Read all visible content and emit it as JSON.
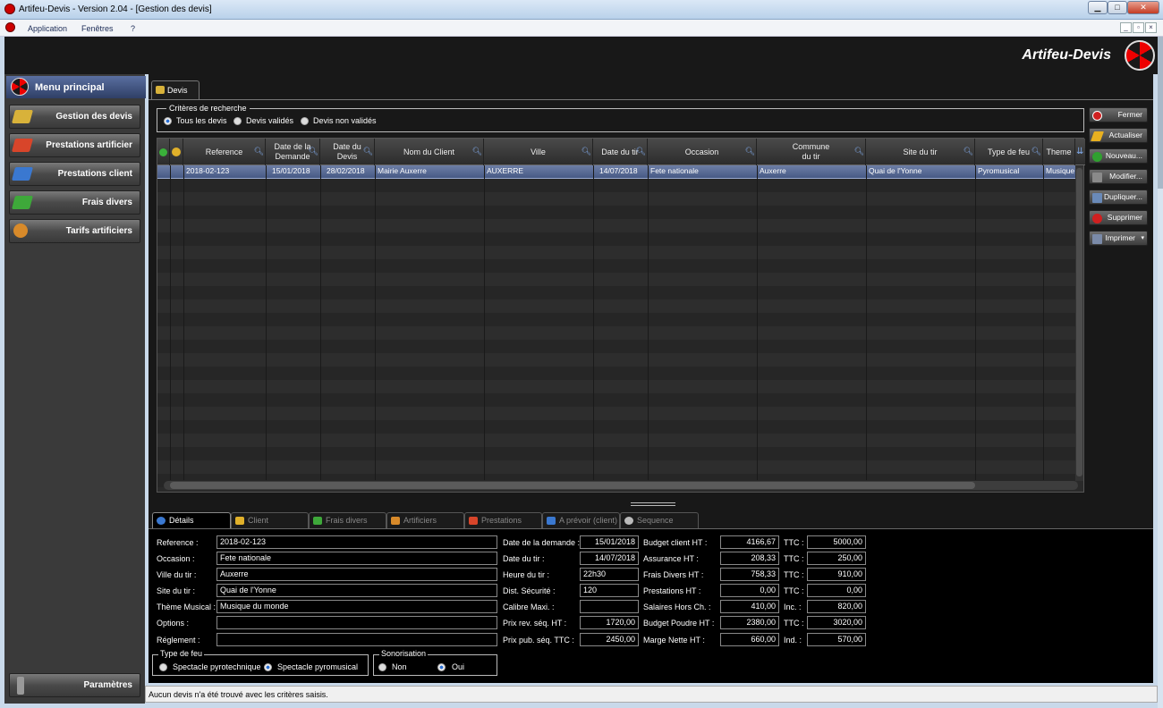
{
  "window": {
    "title": "Artifeu-Devis - Version 2.04 - [Gestion des devis]",
    "minimize": "▁",
    "maximize": "□",
    "close": "✕"
  },
  "menu": {
    "items": [
      "Application",
      "Fenêtres",
      "?"
    ],
    "mdi": [
      "_",
      "▫",
      "×"
    ]
  },
  "brand": "Artifeu-Devis",
  "sidebar": {
    "header": "Menu principal",
    "items": [
      {
        "label": "Gestion des devis",
        "color": "#d8b23a"
      },
      {
        "label": "Prestations artificier",
        "color": "#d8452a"
      },
      {
        "label": "Prestations client",
        "color": "#3a78d0"
      },
      {
        "label": "Frais divers",
        "color": "#3ea83a"
      },
      {
        "label": "Tarifs artificiers",
        "color": "#d88a2a"
      }
    ],
    "footer": "Paramètres"
  },
  "main": {
    "tab": "Devis",
    "criteria": {
      "legend": "Critères de recherche",
      "options": [
        "Tous les devis",
        "Devis validés",
        "Devis non validés"
      ],
      "selected": 0
    },
    "grid": {
      "columns": [
        {
          "label": "Reference"
        },
        {
          "label": "Date de la\nDemande"
        },
        {
          "label": "Date du\nDevis"
        },
        {
          "label": "Nom du Client"
        },
        {
          "label": "Ville"
        },
        {
          "label": "Date du tir"
        },
        {
          "label": "Occasion"
        },
        {
          "label": "Commune\ndu tir"
        },
        {
          "label": "Site du tir"
        },
        {
          "label": "Type de feu"
        },
        {
          "label": "Theme"
        }
      ],
      "rows": [
        [
          "2018-02-123",
          "15/01/2018",
          "28/02/2018",
          "Mairie Auxerre",
          "AUXERRE",
          "14/07/2018",
          "Fete nationale",
          "Auxerre",
          "Quai de l'Yonne",
          "Pyromusical",
          "Musique"
        ]
      ]
    },
    "actions": [
      {
        "label": "Fermer",
        "icon_color": "#d02020"
      },
      {
        "label": "Actualiser",
        "icon_color": "#e8b020"
      },
      {
        "label": "Nouveau...",
        "icon_color": "#30a030"
      },
      {
        "label": "Modifier...",
        "icon_color": "#8a8a8a"
      },
      {
        "label": "Dupliquer...",
        "icon_color": "#6a8ab8"
      },
      {
        "label": "Supprimer",
        "icon_color": "#d02020"
      },
      {
        "label": "Imprimer",
        "icon_color": "#7a8aa8"
      }
    ],
    "bottom_tabs": [
      "Détails",
      "Client",
      "Frais divers",
      "Artificiers",
      "Prestations",
      "A prévoir (client)",
      "Sequence"
    ],
    "details": {
      "left": [
        {
          "label": "Reference :",
          "value": "2018-02-123"
        },
        {
          "label": "Occasion :",
          "value": "Fete nationale"
        },
        {
          "label": "Ville du tir :",
          "value": "Auxerre"
        },
        {
          "label": "Site du tir :",
          "value": "Quai de l'Yonne"
        },
        {
          "label": "Thème Musical :",
          "value": "Musique du monde"
        },
        {
          "label": "Options :",
          "value": ""
        },
        {
          "label": "Réglement :",
          "value": ""
        }
      ],
      "mid": [
        {
          "label": "Date de la demande :",
          "value": "15/01/2018"
        },
        {
          "label": "Date du tir :",
          "value": "14/07/2018"
        },
        {
          "label": "Heure du tir :",
          "value": "22h30"
        },
        {
          "label": "Dist. Sécurité :",
          "value": "120"
        },
        {
          "label": "Calibre Maxi. :",
          "value": ""
        },
        {
          "label": "Prix rev. séq. HT :",
          "value": "1720,00"
        },
        {
          "label": "Prix pub. séq. TTC :",
          "value": "2450,00"
        }
      ],
      "money": [
        {
          "label": "Budget client HT :",
          "value": "4166,67",
          "label2": "TTC :",
          "value2": "5000,00"
        },
        {
          "label": "Assurance HT :",
          "value": "208,33",
          "label2": "TTC :",
          "value2": "250,00"
        },
        {
          "label": "Frais Divers HT :",
          "value": "758,33",
          "label2": "TTC :",
          "value2": "910,00"
        },
        {
          "label": "Prestations HT :",
          "value": "0,00",
          "label2": "TTC :",
          "value2": "0,00"
        },
        {
          "label": "Salaires Hors Ch. :",
          "value": "410,00",
          "label2": "Inc. :",
          "value2": "820,00"
        },
        {
          "label": "Budget Poudre HT :",
          "value": "2380,00",
          "label2": "TTC :",
          "value2": "3020,00"
        },
        {
          "label": "Marge Nette HT :",
          "value": "660,00",
          "label2": "Ind. :",
          "value2": "570,00"
        }
      ],
      "type_feu": {
        "legend": "Type de feu",
        "options": [
          "Spectacle pyrotechnique",
          "Spectacle pyromusical"
        ],
        "selected": 1
      },
      "sonorisation": {
        "legend": "Sonorisation",
        "options": [
          "Non",
          "Oui"
        ],
        "selected": 1
      }
    }
  },
  "status": "Aucun devis n'a été trouvé avec les critères saisis."
}
